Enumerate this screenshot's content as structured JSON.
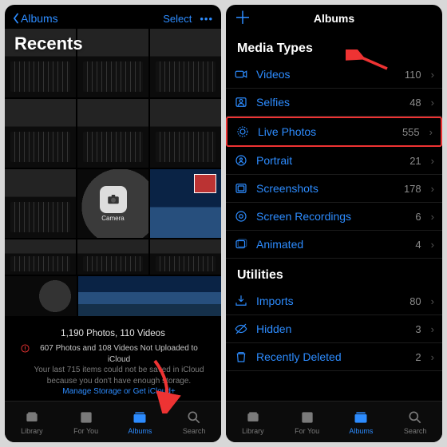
{
  "left": {
    "back_label": "Albums",
    "select_label": "Select",
    "title": "Recents",
    "camera_label": "Camera",
    "summary": "1,190 Photos, 110 Videos",
    "warn_title": "607 Photos and 108 Videos Not Uploaded to iCloud",
    "warn_sub": "Your last 715 items could not be saved in iCloud because you don't have enough storage.",
    "warn_link": "Manage Storage or Get iCloud+"
  },
  "right": {
    "title": "Albums",
    "section_media": "Media Types",
    "section_util": "Utilities",
    "media": [
      {
        "label": "Videos",
        "count": "110"
      },
      {
        "label": "Selfies",
        "count": "48"
      },
      {
        "label": "Live Photos",
        "count": "555"
      },
      {
        "label": "Portrait",
        "count": "21"
      },
      {
        "label": "Screenshots",
        "count": "178"
      },
      {
        "label": "Screen Recordings",
        "count": "6"
      },
      {
        "label": "Animated",
        "count": "4"
      }
    ],
    "util": [
      {
        "label": "Imports",
        "count": "80"
      },
      {
        "label": "Hidden",
        "count": "3"
      },
      {
        "label": "Recently Deleted",
        "count": "2"
      }
    ]
  },
  "tabs": {
    "library": "Library",
    "foryou": "For You",
    "albums": "Albums",
    "search": "Search"
  }
}
